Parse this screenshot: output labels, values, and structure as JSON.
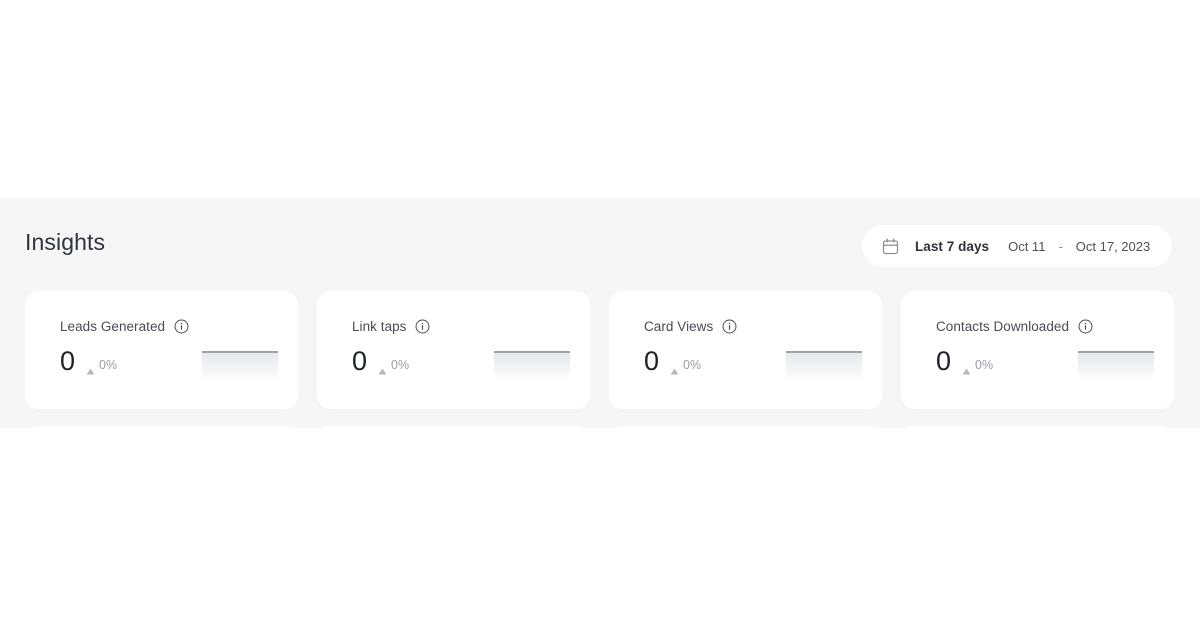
{
  "panel": {
    "title": "Insights",
    "background_color": "#f6f6f6"
  },
  "date_range": {
    "icon": "calendar-icon",
    "preset_label": "Last 7 days",
    "start_date": "Oct 11",
    "separator": "-",
    "end_date": "Oct 17, 2023"
  },
  "metrics": [
    {
      "title": "Leads Generated",
      "info_icon": "info-icon",
      "value": "0",
      "trend_direction": "up",
      "change": "0%",
      "sparkline": {
        "type": "flat",
        "color": "#9ea1a7"
      }
    },
    {
      "title": "Link taps",
      "info_icon": "info-icon",
      "value": "0",
      "trend_direction": "up",
      "change": "0%",
      "sparkline": {
        "type": "flat",
        "color": "#9ea1a7"
      }
    },
    {
      "title": "Card Views",
      "info_icon": "info-icon",
      "value": "0",
      "trend_direction": "up",
      "change": "0%",
      "sparkline": {
        "type": "flat",
        "color": "#9ea1a7"
      }
    },
    {
      "title": "Contacts Downloaded",
      "info_icon": "info-icon",
      "value": "0",
      "trend_direction": "up",
      "change": "0%",
      "sparkline": {
        "type": "flat",
        "color": "#9ea1a7"
      }
    }
  ],
  "colors": {
    "panel_bg": "#f6f6f6",
    "card_bg": "#ffffff",
    "title_text": "#31343d",
    "label_text": "#494c54",
    "value_text": "#20222a",
    "muted_text": "#9a9da4",
    "sparkline_line": "#9ea1a7"
  }
}
